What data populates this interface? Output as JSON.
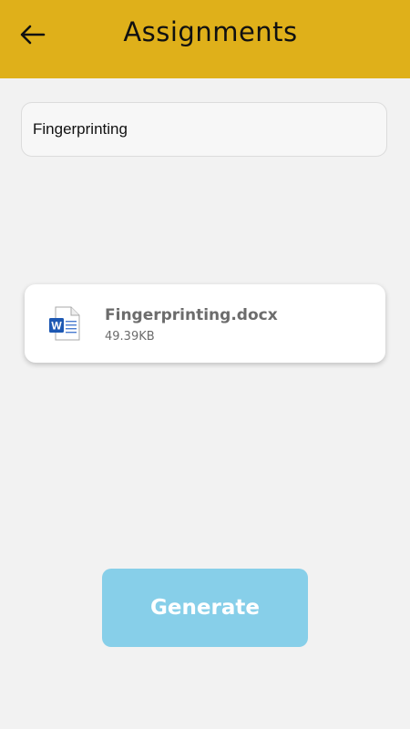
{
  "header": {
    "title": "Assignments",
    "back_icon": "arrow-left-icon",
    "background_color": "#dfb01a"
  },
  "form": {
    "title_input_value": "Fingerprinting"
  },
  "file": {
    "name": "Fingerprinting.docx",
    "size": "49.39KB",
    "icon": "word-document-icon",
    "icon_badge": "W"
  },
  "actions": {
    "generate_label": "Generate",
    "generate_color": "#87cfe9"
  }
}
